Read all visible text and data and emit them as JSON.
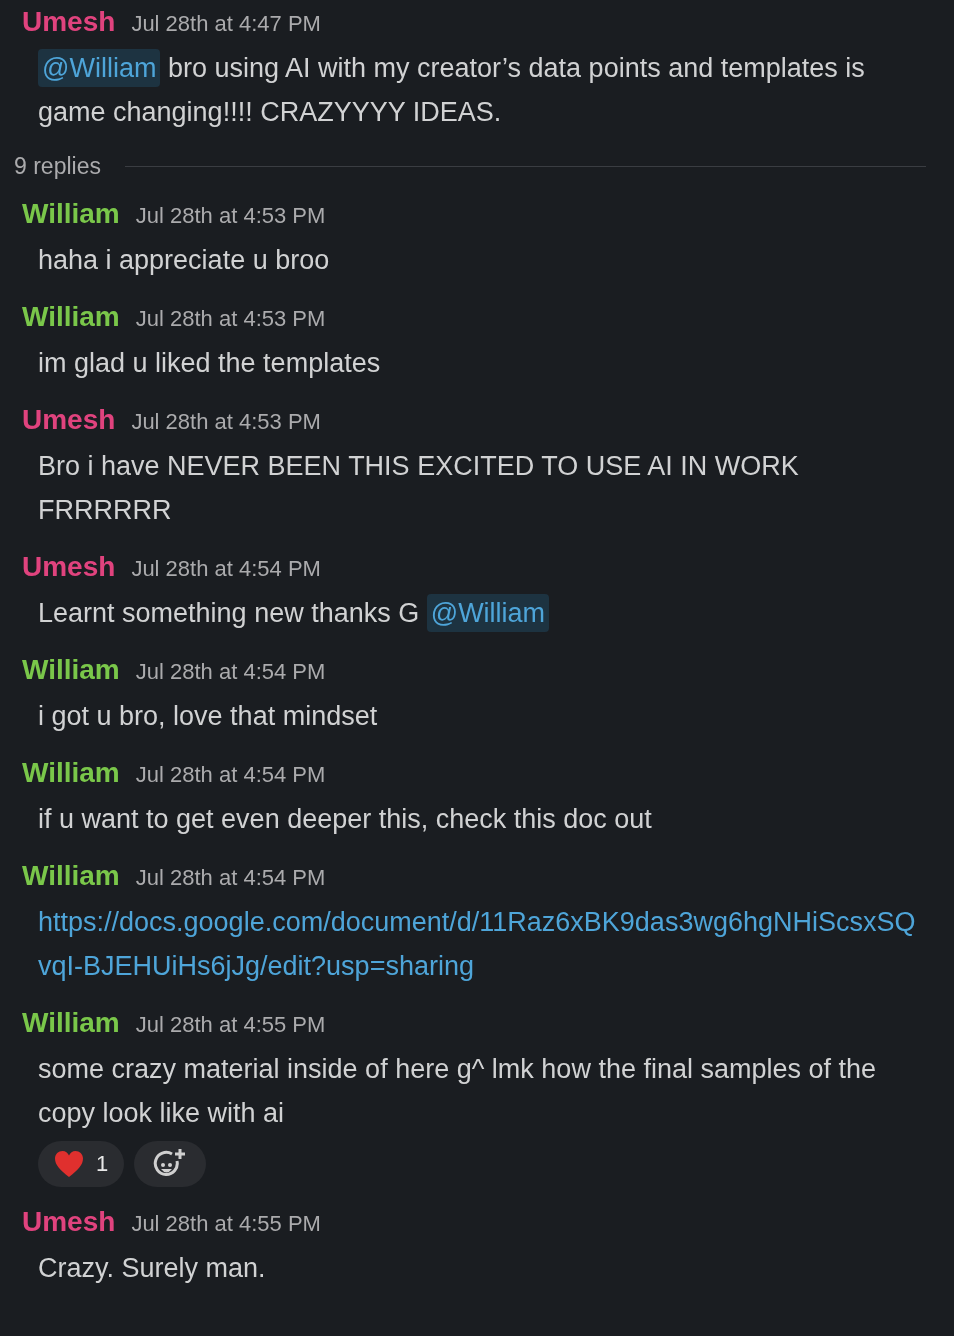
{
  "parent": {
    "author": "Umesh",
    "color": "#e0437e",
    "time": "Jul 28th at 4:47 PM",
    "body": [
      {
        "kind": "mention",
        "text": "@William"
      },
      {
        "kind": "text",
        "text": " bro using AI with my creator’s data points and templates is game changing!!!! CRAZYYYY IDEAS."
      }
    ]
  },
  "replies_count": "9 replies",
  "messages": [
    {
      "author": "William",
      "color": "#7ac74a",
      "time": "Jul 28th at 4:53 PM",
      "body": [
        {
          "kind": "text",
          "text": "haha i appreciate u broo"
        }
      ]
    },
    {
      "author": "William",
      "color": "#7ac74a",
      "time": "Jul 28th at 4:53 PM",
      "body": [
        {
          "kind": "text",
          "text": "im glad u liked the templates"
        }
      ]
    },
    {
      "author": "Umesh",
      "color": "#e0437e",
      "time": "Jul 28th at 4:53 PM",
      "body": [
        {
          "kind": "text",
          "text": "Bro i have NEVER BEEN THIS EXCITED TO USE AI IN WORK FRRRRRR"
        }
      ]
    },
    {
      "author": "Umesh",
      "color": "#e0437e",
      "time": "Jul 28th at 4:54 PM",
      "body": [
        {
          "kind": "text",
          "text": "Learnt something new thanks G "
        },
        {
          "kind": "mention",
          "text": "@William"
        }
      ]
    },
    {
      "author": "William",
      "color": "#7ac74a",
      "time": "Jul 28th at 4:54 PM",
      "body": [
        {
          "kind": "text",
          "text": "i got u bro, love that mindset"
        }
      ]
    },
    {
      "author": "William",
      "color": "#7ac74a",
      "time": "Jul 28th at 4:54 PM",
      "body": [
        {
          "kind": "text",
          "text": "if u want to get even deeper this, check this doc out"
        }
      ]
    },
    {
      "author": "William",
      "color": "#7ac74a",
      "time": "Jul 28th at 4:54 PM",
      "body": [
        {
          "kind": "link",
          "text": "https://docs.google.com/document/d/11Raz6xBK9das3wg6hgNHiScsxSQvqI-BJEHUiHs6jJg/edit?usp=sharing"
        }
      ]
    },
    {
      "author": "William",
      "color": "#7ac74a",
      "time": "Jul 28th at 4:55 PM",
      "body": [
        {
          "kind": "text",
          "text": "some crazy material inside of here g^ lmk how the final samples of the copy look like with ai"
        }
      ],
      "reactions": [
        {
          "kind": "heart",
          "count": "1"
        }
      ],
      "add_reaction": true
    },
    {
      "author": "Umesh",
      "color": "#e0437e",
      "time": "Jul 28th at 4:55 PM",
      "body": [
        {
          "kind": "text",
          "text": "Crazy. Surely man."
        }
      ]
    }
  ]
}
